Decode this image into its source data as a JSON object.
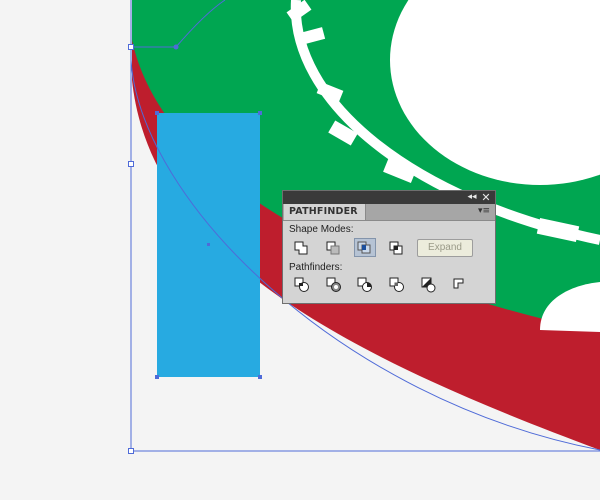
{
  "panel": {
    "tab_label": "PATHFINDER",
    "collapse_glyph": "◂◂",
    "close_glyph": "✕",
    "menu_glyph": "▾≡",
    "shape_modes_label": "Shape Modes:",
    "pathfinders_label": "Pathfinders:",
    "expand_label": "Expand",
    "expand_enabled": false,
    "shape_mode_buttons": [
      "unite",
      "minus-front",
      "intersect",
      "exclude"
    ],
    "pathfinder_buttons": [
      "divide",
      "trim",
      "merge",
      "crop",
      "outline",
      "minus-back"
    ],
    "selected_shape_mode": "intersect"
  },
  "colors": {
    "chip_green": "#00a651",
    "chip_red": "#be1e2d",
    "rectangle_blue": "#27aae1",
    "selection_guide": "#4f6bd8",
    "canvas_bg": "#f4f4f4"
  }
}
